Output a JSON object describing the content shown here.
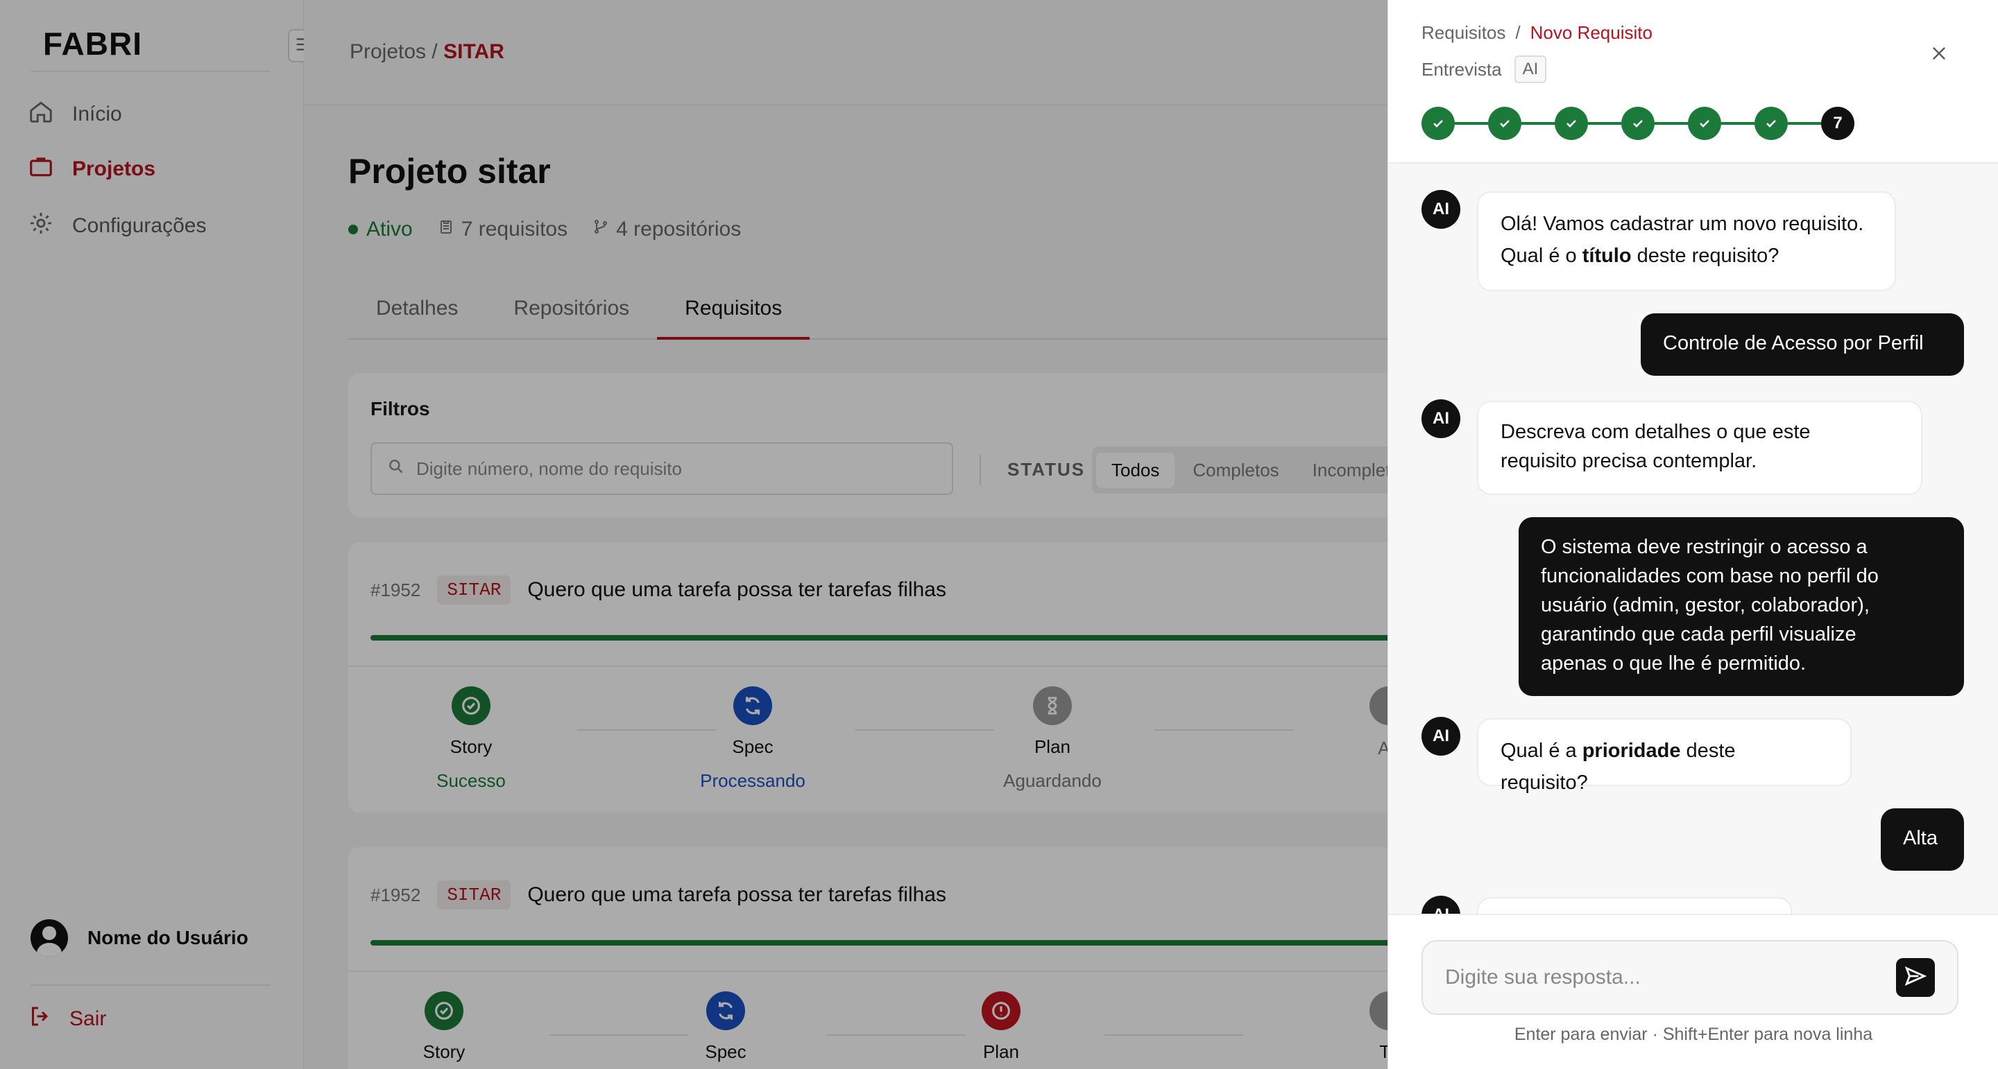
{
  "app": {
    "logo": "FABRI"
  },
  "sidebar": {
    "items": [
      {
        "label": "Início",
        "icon": "home-icon"
      },
      {
        "label": "Projetos",
        "icon": "briefcase-icon"
      },
      {
        "label": "Configurações",
        "icon": "gear-icon"
      }
    ],
    "user_name": "Nome do Usuário",
    "logout_label": "Sair"
  },
  "header": {
    "breadcrumb_parent": "Projetos",
    "breadcrumb_sep": "/",
    "breadcrumb_current": "SITAR"
  },
  "project": {
    "title": "Projeto sitar",
    "status": "Ativo",
    "requirements_count": "7 requisitos",
    "repos_count": "4 repositórios"
  },
  "tabs": [
    "Detalhes",
    "Repositórios",
    "Requisitos"
  ],
  "filters": {
    "title": "Filtros",
    "search_placeholder": "Digite número, nome do requisito",
    "status_label": "STATUS",
    "options": [
      "Todos",
      "Completos",
      "Incompletos"
    ]
  },
  "requirements": [
    {
      "id": "#1952",
      "tag": "SITAR",
      "title": "Quero que uma tarefa possa ter tarefas filhas",
      "steps": [
        {
          "name": "Story",
          "status": "Sucesso"
        },
        {
          "name": "Spec",
          "status": "Processando"
        },
        {
          "name": "Plan",
          "status": "Aguardando"
        },
        {
          "name": "",
          "status": "Ag"
        }
      ]
    },
    {
      "id": "#1952",
      "tag": "SITAR",
      "title": "Quero que uma tarefa possa ter tarefas filhas",
      "steps": [
        {
          "name": "Story",
          "status": ""
        },
        {
          "name": "Spec",
          "status": ""
        },
        {
          "name": "Plan",
          "status": ""
        },
        {
          "name": "To",
          "status": ""
        }
      ]
    }
  ],
  "drawer": {
    "crumb_parent": "Requisitos",
    "crumb_sep": "/",
    "crumb_current": "Novo Requisito",
    "subtitle": "Entrevista",
    "chip": "AI",
    "current_step": "7",
    "close_label": "×",
    "messages": [
      {
        "from": "ai",
        "avatar": "AI",
        "line1": "Olá! Vamos cadastrar um novo requisito.",
        "line2_pre": "Qual é o ",
        "line2_bold": "título",
        "line2_post": " deste requisito?"
      },
      {
        "from": "user",
        "text": "Controle de Acesso por Perfil"
      },
      {
        "from": "ai",
        "avatar": "AI",
        "line1": "Descreva com detalhes o que este",
        "line2": "requisito precisa contemplar."
      },
      {
        "from": "user",
        "lines": [
          "O sistema deve restringir o acesso a",
          "funcionalidades com base no perfil do",
          "usuário (admin, gestor, colaborador),",
          "garantindo que cada perfil visualize",
          "apenas o que lhe é permitido."
        ]
      },
      {
        "from": "ai",
        "avatar": "AI",
        "pre": "Qual é a ",
        "bold": "prioridade",
        "post": " deste requisito?"
      },
      {
        "from": "user",
        "text": "Alta"
      },
      {
        "from": "ai",
        "avatar": "AI"
      }
    ],
    "input_placeholder": "Digite sua resposta...",
    "hint": "Enter para enviar · Shift+Enter para nova linha"
  },
  "colors": {
    "accent": "#b3141d",
    "success": "#1b7a3a",
    "processing": "#1a4fbf",
    "error": "#c0161e",
    "pending": "#9a9a9a"
  }
}
